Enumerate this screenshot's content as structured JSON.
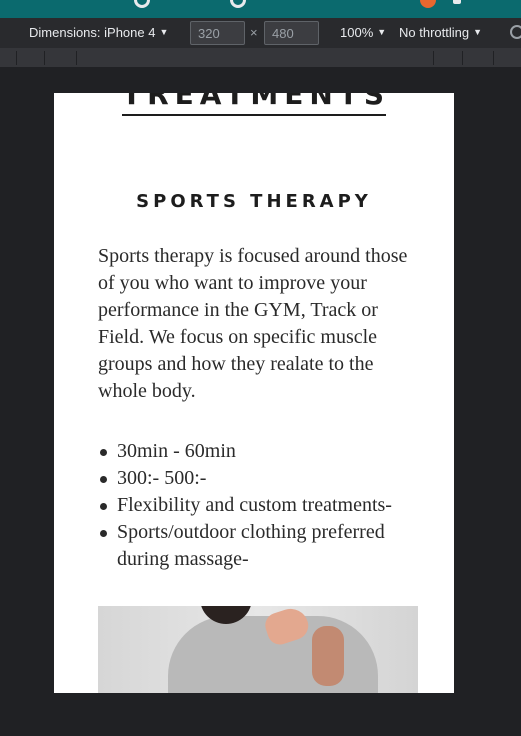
{
  "devtools": {
    "dimensions_label": "Dimensions: iPhone 4",
    "width_value": "320",
    "times_symbol": "×",
    "height_value": "480",
    "zoom_label": "100%",
    "throttling_label": "No throttling",
    "caret_glyph": "▼"
  },
  "page": {
    "heading": "TREATMENTS",
    "section_title": "SPORTS THERAPY",
    "section_body": "Sports therapy is focused around those of you who want to improve your performance in the GYM, Track or Field. We focus on specific muscle groups and how they realate to the whole body.",
    "features": [
      "30min - 60min",
      "300:- 500:-",
      "Flexibility and custom treatments-",
      "Sports/outdoor clothing preferred during massage-"
    ]
  },
  "colors": {
    "browser_accent": "#0b6a6e",
    "toolbar_bg": "#292a2d",
    "devtools_bg": "#202124",
    "page_bg": "#ffffff",
    "text_dark": "#1d1d1d"
  },
  "icons": [
    "tab-icon",
    "tab-icon",
    "notification-icon",
    "tab-icon",
    "more-options-icon"
  ]
}
